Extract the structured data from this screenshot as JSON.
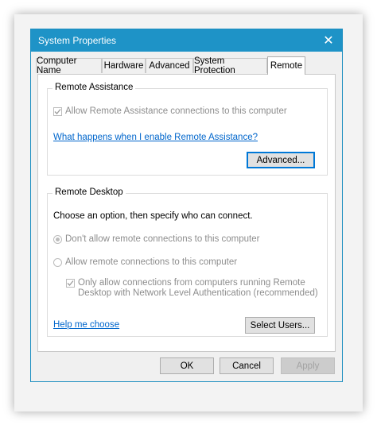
{
  "window": {
    "title": "System Properties",
    "close_glyph": "✕"
  },
  "tabs": [
    {
      "label": "Computer Name"
    },
    {
      "label": "Hardware"
    },
    {
      "label": "Advanced"
    },
    {
      "label": "System Protection"
    },
    {
      "label": "Remote",
      "active": true
    }
  ],
  "remote_assistance": {
    "group_label": "Remote Assistance",
    "allow_checkbox": {
      "label": "Allow Remote Assistance connections to this computer",
      "checked": true,
      "enabled": false
    },
    "help_link": "What happens when I enable Remote Assistance?",
    "advanced_button": "Advanced..."
  },
  "remote_desktop": {
    "group_label": "Remote Desktop",
    "instructions": "Choose an option, then specify who can connect.",
    "option_dont_allow": {
      "label": "Don't allow remote connections to this computer",
      "selected": true,
      "enabled": false
    },
    "option_allow": {
      "label": "Allow remote connections to this computer",
      "selected": false,
      "enabled": false
    },
    "nla_checkbox": {
      "label_line1": "Only allow connections from computers running Remote",
      "label_line2": "Desktop with Network Level Authentication (recommended)",
      "checked": true,
      "enabled": false
    },
    "help_link": "Help me choose",
    "select_users_button": "Select Users..."
  },
  "footer": {
    "ok": "OK",
    "cancel": "Cancel",
    "apply": "Apply"
  },
  "colors": {
    "titlebar": "#1e93c7",
    "link": "#0066cc",
    "default_button_border": "#0078d7",
    "disabled_text": "#8d8d8d"
  }
}
